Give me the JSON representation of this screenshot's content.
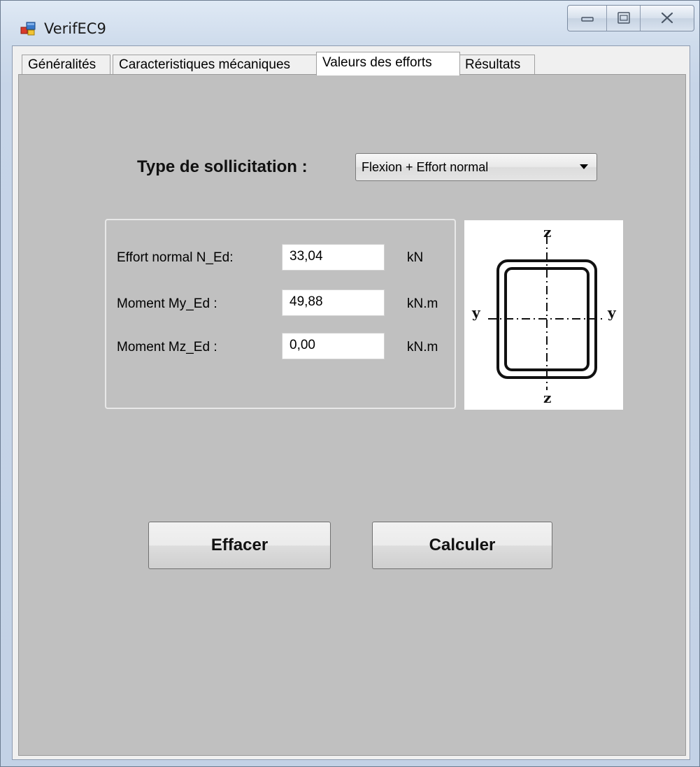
{
  "window": {
    "title": "VerifEC9"
  },
  "tabs": [
    {
      "label": "Généralités"
    },
    {
      "label": "Caracteristiques mécaniques"
    },
    {
      "label": "Valeurs des efforts"
    },
    {
      "label": "Résultats"
    }
  ],
  "active_tab": "Valeurs des efforts",
  "form": {
    "type_label": "Type de sollicitation :",
    "type_value": "Flexion + Effort normal",
    "fields": [
      {
        "label": "Effort normal  N_Ed:",
        "value": "33,04",
        "unit": "kN"
      },
      {
        "label": "Moment My_Ed :",
        "value": "49,88",
        "unit": "kN.m"
      },
      {
        "label": "Moment Mz_Ed :",
        "value": "0,00",
        "unit": "kN.m"
      }
    ]
  },
  "diagram": {
    "axis_z_top": "z",
    "axis_z_bottom": "z",
    "axis_y_left": "y",
    "axis_y_right": "y"
  },
  "buttons": {
    "clear": "Effacer",
    "calculate": "Calculer"
  }
}
